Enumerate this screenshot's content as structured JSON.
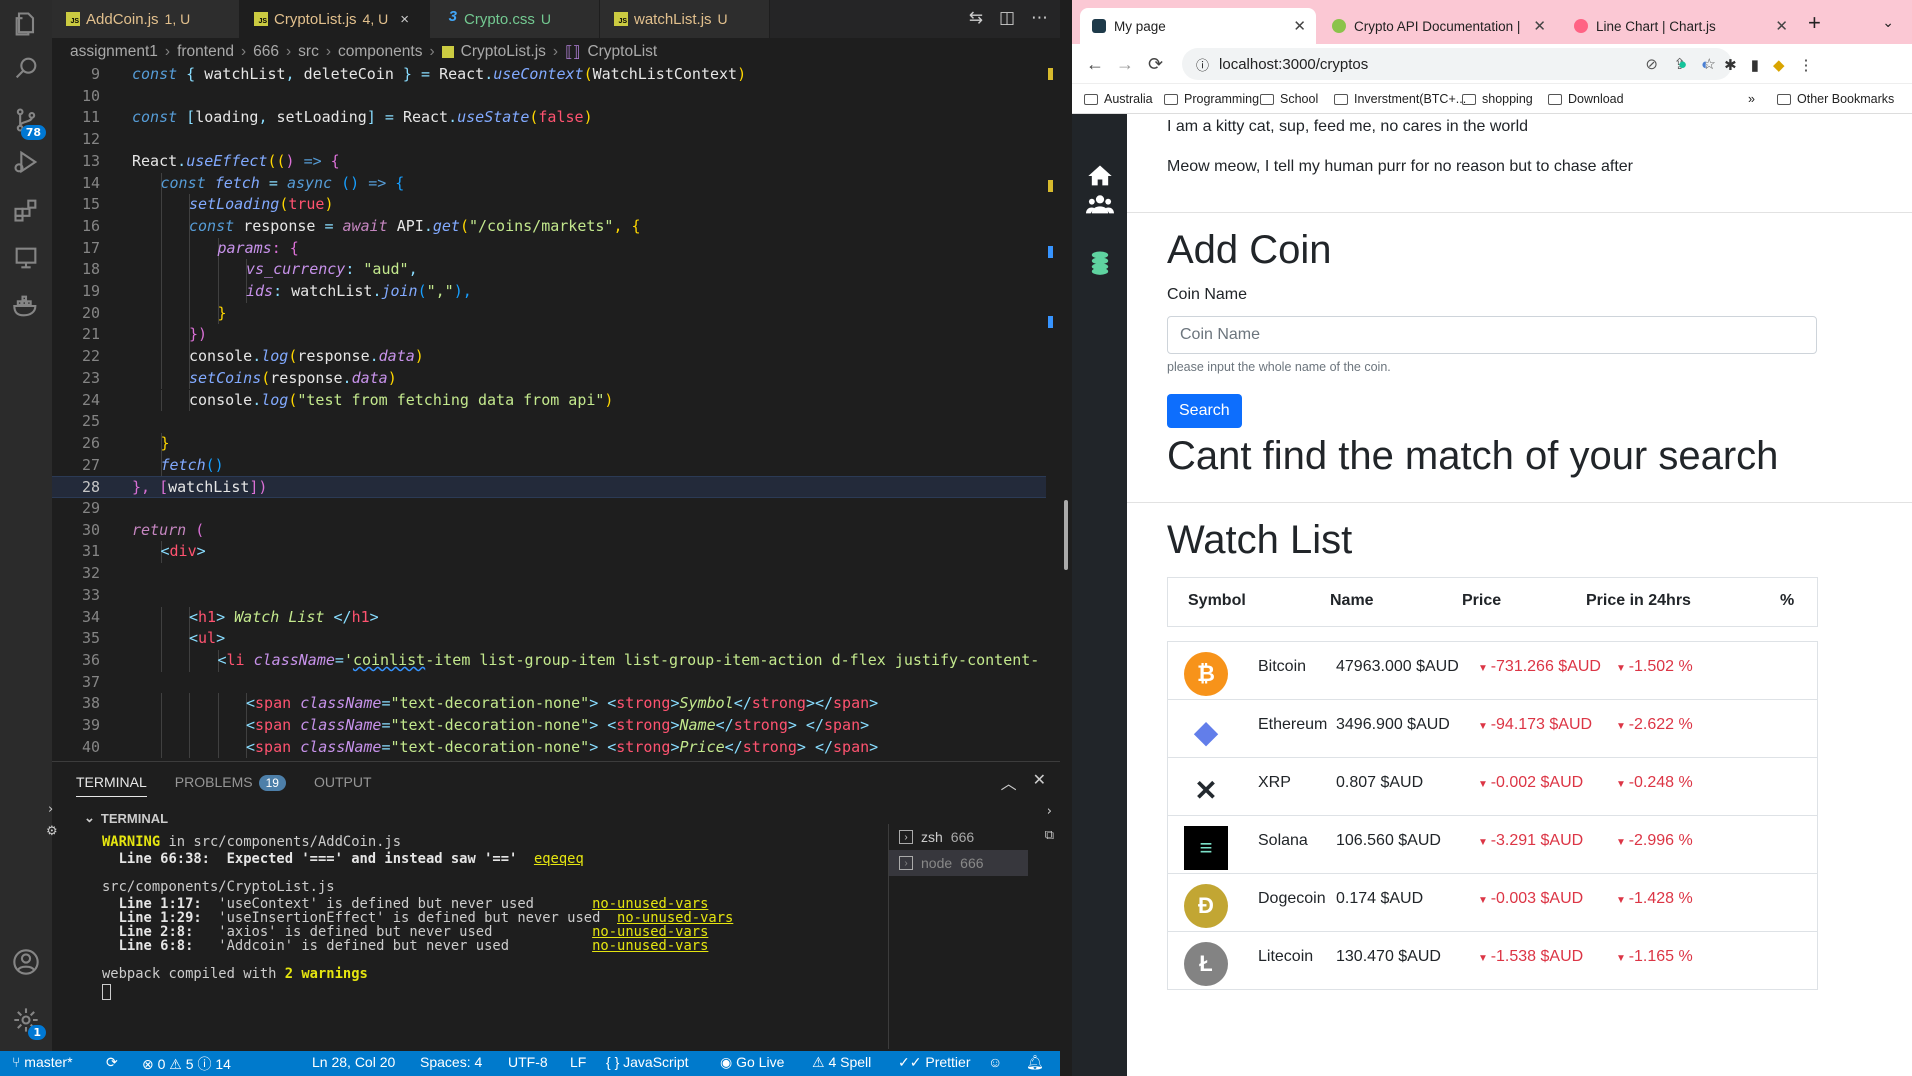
{
  "vscode": {
    "tabs": [
      {
        "name": "AddCoin.js",
        "status": "1, U"
      },
      {
        "name": "CryptoList.js",
        "status": "4, U",
        "close": "×"
      },
      {
        "name": "Crypto.css",
        "status": "U"
      },
      {
        "name": "watchList.js",
        "status": "U"
      }
    ],
    "breadcrumb": [
      "assignment1",
      "frontend",
      "666",
      "src",
      "components",
      "CryptoList.js",
      "CryptoList"
    ],
    "activity_badges": {
      "source_control": "78",
      "accounts": "1"
    },
    "panel": {
      "tabs": [
        "TERMINAL",
        "PROBLEMS",
        "OUTPUT"
      ],
      "problems_count": "19",
      "terminal_header": "TERMINAL",
      "sessions": [
        {
          "name": "zsh",
          "id": "666"
        },
        {
          "name": "node",
          "id": "666"
        }
      ],
      "output": {
        "warn_word": "WARNING",
        "warn_file": " in src/components/AddCoin.js",
        "warn_line": "  Line 66:38:  Expected '===' and instead saw '=='  ",
        "warn_rule": "eqeqeq",
        "file2": "src/components/CryptoList.js",
        "items": [
          {
            "loc": "  Line 1:17:",
            "msg": "  'useContext' is defined but never used       ",
            "rule": "no-unused-vars"
          },
          {
            "loc": "  Line 1:29:",
            "msg": "  'useInsertionEffect' is defined but never used  ",
            "rule": "no-unused-vars"
          },
          {
            "loc": "  Line 2:8: ",
            "msg": "  'axios' is defined but never used            ",
            "rule": "no-unused-vars"
          },
          {
            "loc": "  Line 6:8: ",
            "msg": "  'Addcoin' is defined but never used          ",
            "rule": "no-unused-vars"
          }
        ],
        "compiled_pre": "webpack compiled with ",
        "compiled_count": "2 warnings"
      }
    },
    "statusbar": {
      "branch": "master*",
      "errors": "0",
      "warnings": "5",
      "info": "14",
      "position": "Ln 28, Col 20",
      "spaces": "Spaces: 4",
      "encoding": "UTF-8",
      "eol": "LF",
      "language": "JavaScript",
      "golive": "Go Live",
      "spell": "4 Spell",
      "prettier": "Prettier"
    }
  },
  "chrome": {
    "tabs": [
      {
        "title": "My page"
      },
      {
        "title": "Crypto API Documentation | Co"
      },
      {
        "title": "Line Chart | Chart.js"
      }
    ],
    "url": "localhost:3000/cryptos",
    "bookmarks": [
      "Australia",
      "Programming",
      "School",
      "Inverstment(BTC+...",
      "shopping",
      "Download"
    ],
    "more_bookmarks": "»",
    "other_bookmarks": "Other Bookmarks",
    "page": {
      "para1": "I am a kitty cat, sup, feed me, no cares in the world",
      "para2": "Meow meow, I tell my human purr for no reason but to chase after",
      "add_title": "Add Coin",
      "coin_label": "Coin Name",
      "coin_placeholder": "Coin Name",
      "help": "please input the whole name of the coin.",
      "search_btn": "Search",
      "no_match": "Cant find the match of your search",
      "watch_title": "Watch List",
      "headers": [
        "Symbol",
        "Name",
        "Price",
        "Price in 24hrs",
        "%"
      ],
      "coins": [
        {
          "name": "Bitcoin",
          "price": "47963.000 $AUD",
          "change": "-731.266 $AUD",
          "pct": "-1.502 %",
          "color": "#f7931a"
        },
        {
          "name": "Ethereum",
          "price": "3496.900 $AUD",
          "change": "-94.173 $AUD",
          "pct": "-2.622 %",
          "color": "#627eea"
        },
        {
          "name": "XRP",
          "price": "0.807 $AUD",
          "change": "-0.002 $AUD",
          "pct": "-0.248 %",
          "color": "#23292f"
        },
        {
          "name": "Solana",
          "price": "106.560 $AUD",
          "change": "-3.291 $AUD",
          "pct": "-2.996 %",
          "color": "#000000"
        },
        {
          "name": "Dogecoin",
          "price": "0.174 $AUD",
          "change": "-0.003 $AUD",
          "pct": "-1.428 %",
          "color": "#c2a633"
        },
        {
          "name": "Litecoin",
          "price": "130.470 $AUD",
          "change": "-1.538 $AUD",
          "pct": "-1.165 %",
          "color": "#838383"
        }
      ]
    }
  },
  "code_lines": [
    {
      "n": "9"
    },
    {
      "n": "10"
    },
    {
      "n": "11"
    },
    {
      "n": "12"
    },
    {
      "n": "13"
    },
    {
      "n": "14"
    },
    {
      "n": "15"
    },
    {
      "n": "16"
    },
    {
      "n": "17"
    },
    {
      "n": "18"
    },
    {
      "n": "19"
    },
    {
      "n": "20"
    },
    {
      "n": "21"
    },
    {
      "n": "22"
    },
    {
      "n": "23"
    },
    {
      "n": "24"
    },
    {
      "n": "25"
    },
    {
      "n": "26"
    },
    {
      "n": "27"
    },
    {
      "n": "28"
    },
    {
      "n": "29"
    },
    {
      "n": "30"
    },
    {
      "n": "31"
    },
    {
      "n": "32"
    },
    {
      "n": "33"
    },
    {
      "n": "34"
    },
    {
      "n": "35"
    },
    {
      "n": "36"
    },
    {
      "n": "37"
    },
    {
      "n": "38"
    },
    {
      "n": "39"
    },
    {
      "n": "40"
    }
  ],
  "code_text": {
    "l9": [
      "const",
      " { ",
      "watchList",
      ", ",
      "deleteCoin",
      " } = ",
      "React",
      ".",
      "useContext",
      "(",
      "WatchListContext",
      ")"
    ],
    "l11": [
      "const",
      " [",
      "loading",
      ", ",
      "setLoading",
      "] = ",
      "React",
      ".",
      "useState",
      "(",
      "false",
      ")"
    ],
    "l13": [
      "React",
      ".",
      "useEffect",
      "((",
      ") ",
      "=>",
      " {"
    ],
    "l14": [
      "const",
      " ",
      "fetch",
      " = ",
      "async",
      " () ",
      "=>",
      " {"
    ],
    "l15": [
      "setLoading",
      "(",
      "true",
      ")"
    ],
    "l16": [
      "const",
      " ",
      "response",
      " = ",
      "await",
      " ",
      "API",
      ".",
      "get",
      "(",
      "\"/coins/markets\"",
      ", {"
    ],
    "l17": [
      "params",
      ": {"
    ],
    "l18": [
      "vs_currency",
      ": ",
      "\"aud\"",
      ","
    ],
    "l19": [
      "ids",
      ": ",
      "watchList",
      ".",
      "join",
      "(",
      "\",\"",
      "),"
    ],
    "l20": [
      "}"
    ],
    "l21": [
      "})"
    ],
    "l22": [
      "console",
      ".",
      "log",
      "(",
      "response",
      ".",
      "data",
      ")"
    ],
    "l23": [
      "setCoins",
      "(",
      "response",
      ".",
      "data",
      ")"
    ],
    "l24": [
      "console",
      ".",
      "log",
      "(",
      "\"test from fetching data from api\"",
      ")"
    ],
    "l26": [
      "}"
    ],
    "l27": [
      "fetch",
      "()"
    ],
    "l28": [
      "}, [",
      "watchList",
      "])"
    ],
    "l30": [
      "return",
      " ("
    ],
    "l31": [
      "<",
      "div",
      ">"
    ],
    "l34": [
      "<",
      "h1",
      "> ",
      "Watch List",
      " </",
      "h1",
      ">"
    ],
    "l35": [
      "<",
      "ul",
      ">"
    ],
    "l36": [
      "<",
      "li",
      " ",
      "className",
      "=",
      "'",
      "coinlist",
      "-item list-group-item list-group-item-action d-flex justify-content-"
    ],
    "l38": [
      "<",
      "span",
      " ",
      "className",
      "=",
      "\"text-decoration-none\"",
      "> <",
      "strong",
      ">",
      "Symbol",
      "</",
      "strong",
      "></",
      "span",
      ">"
    ],
    "l39": [
      "<",
      "span",
      " ",
      "className",
      "=",
      "\"text-decoration-none\"",
      "> <",
      "strong",
      ">",
      "Name",
      "</",
      "strong",
      "> </",
      "span",
      ">"
    ],
    "l40": [
      "<",
      "span",
      " ",
      "className",
      "=",
      "\"text-decoration-none\"",
      "> <",
      "strong",
      ">",
      "Price",
      "</",
      "strong",
      "> </",
      "span",
      ">"
    ]
  }
}
